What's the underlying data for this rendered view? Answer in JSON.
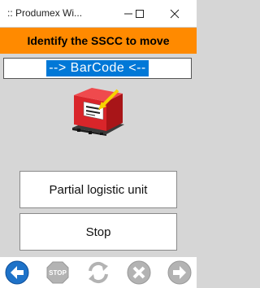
{
  "window": {
    "title": ":: Produmex Wi..."
  },
  "banner": {
    "text": "Identify the SSCC to move"
  },
  "scan": {
    "value": "--> BarCode <--"
  },
  "buttons": {
    "partial": "Partial logistic unit",
    "stop": "Stop"
  },
  "footer": {
    "icons": [
      "back-arrow-icon",
      "stop-sign-icon",
      "refresh-icon",
      "cancel-x-icon",
      "forward-arrow-icon"
    ],
    "stop_sign_text": "STOP"
  },
  "colors": {
    "banner": "#ff8a00",
    "selection": "#0078d7",
    "back_active": "#1e72c8",
    "disabled": "#b3b3b3"
  }
}
